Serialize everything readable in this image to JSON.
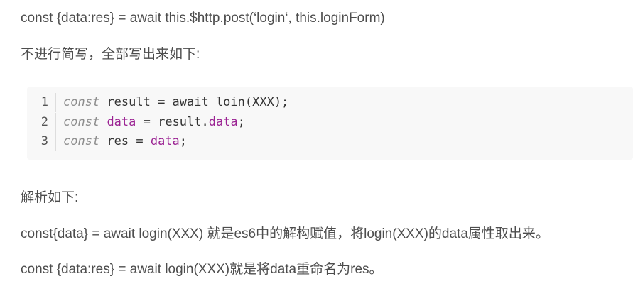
{
  "paragraphs": {
    "p1": "const {data:res} = await this.$http.post(‘login‘, this.loginForm)",
    "p2": "不进行简写，全部写出来如下:",
    "p3": "解析如下:",
    "p4": "const{data} = await login(XXX) 就是es6中的解构赋值，将login(XXX)的data属性取出来。",
    "p5": "const {data:res} = await login(XXX)就是将data重命名为res。"
  },
  "code": {
    "lines": [
      {
        "num": "1",
        "kw": "const",
        "a": " result = await loin(XXX);",
        "b": "",
        "c": ""
      },
      {
        "num": "2",
        "kw": "const",
        "a": " ",
        "b": "data",
        "c": " = result.",
        "d": "data",
        "e": ";"
      },
      {
        "num": "3",
        "kw": "const",
        "a": " res = ",
        "b": "data",
        "c": ";"
      }
    ]
  },
  "colors": {
    "text": "#4d4d4d",
    "code_bg": "#f8f8f8",
    "keyword": "#8d8d8d",
    "property": "#9b2393"
  }
}
